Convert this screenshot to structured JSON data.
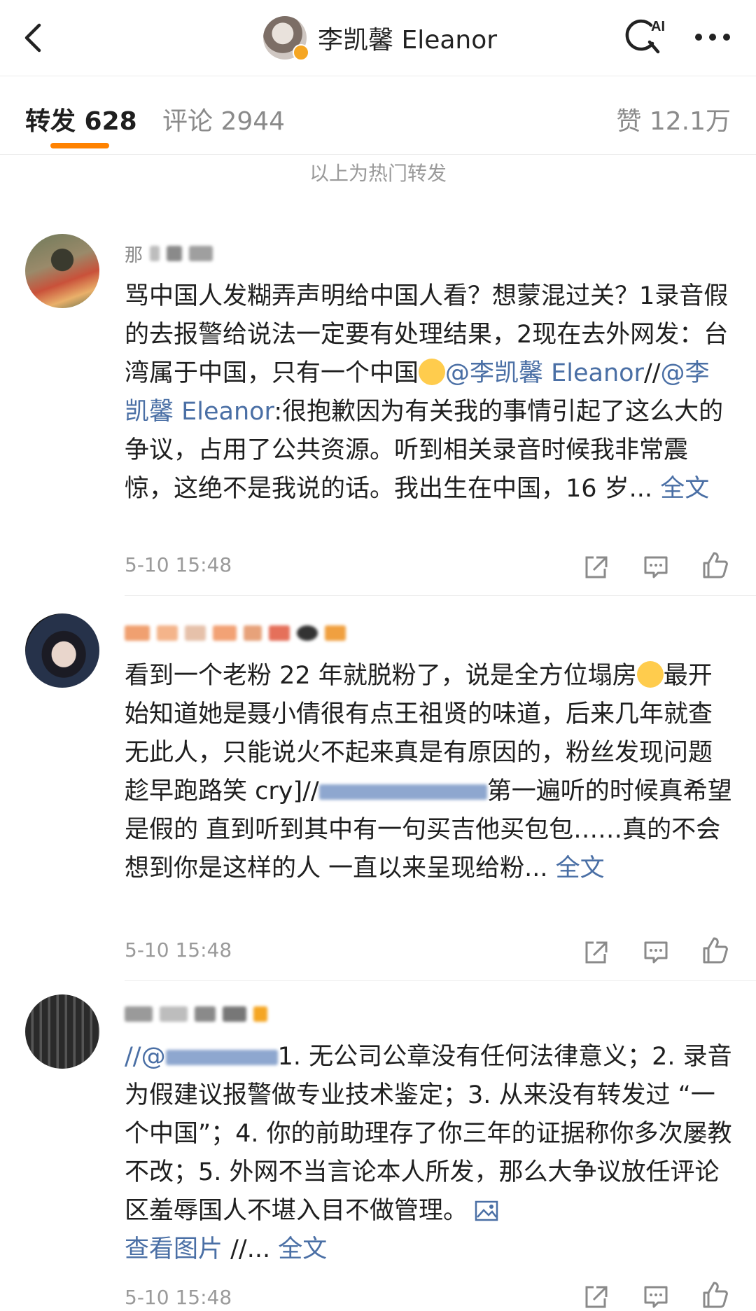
{
  "header": {
    "title": "李凯馨 Eleanor",
    "back_icon": "chevron-left-icon",
    "ai_icon": "ai-search-icon",
    "more_icon": "more-horizontal-icon"
  },
  "tabs": {
    "forward": "转发 628",
    "comment": "评论 2944",
    "like": "赞 12.1万",
    "accent": "#ff8200"
  },
  "hot_note": "以上为热门转发",
  "comments": [
    {
      "name_visible": "那",
      "text_1": "骂中国人发糊弄声明给中国人看？想蒙混过关？1录音假的去报警给说法一定要有处理结果，2现在去外网发：台湾属于中国，只有一个中国",
      "mention_1": "@李凯馨 Eleanor",
      "sep": "//",
      "mention_2": "@李凯馨 Eleanor",
      "text_2": ":很抱歉因为有关我的事情引起了这么大的争议，占用了公共资源。听到相关录音时候我非常震惊，这绝不是我说的话。我出生在中国，16 岁...",
      "full_link": "全文",
      "time": "5-10 15:48"
    },
    {
      "text_1": "看到一个老粉 22 年就脱粉了，说是全方位塌房",
      "text_2": "最开始知道她是聂小倩很有点王祖贤的味道，后来几年就查无此人，只能说火不起来真是有原因的，粉丝发现问题趁早跑路笑 cry]//",
      "text_3": "第一遍听的时候真希望是假的 直到听到其中有一句买吉他买包包……真的不会想到你是这样的人 一直以来呈现给粉...",
      "full_link": "全文",
      "time": "5-10 15:48"
    },
    {
      "prefix": "//@",
      "text_1": "1. 无公司公章没有任何法律意义；2. 录音为假建议报警做专业技术鉴定；3. 从来没有转发过 “一个中国”；4. 你的前助理存了你三年的证据称你多次屡教不改；5. 外网不当言论本人所发，那么大争议放任评论区羞辱国人不堪入目不做管理。",
      "view_image": "查看图片",
      "tail": " //...",
      "full_link": "全文",
      "time": "5-10 15:48"
    }
  ],
  "actions": {
    "share_icon": "share-icon",
    "comment_icon": "comment-icon",
    "like_icon": "thumbs-up-icon"
  }
}
